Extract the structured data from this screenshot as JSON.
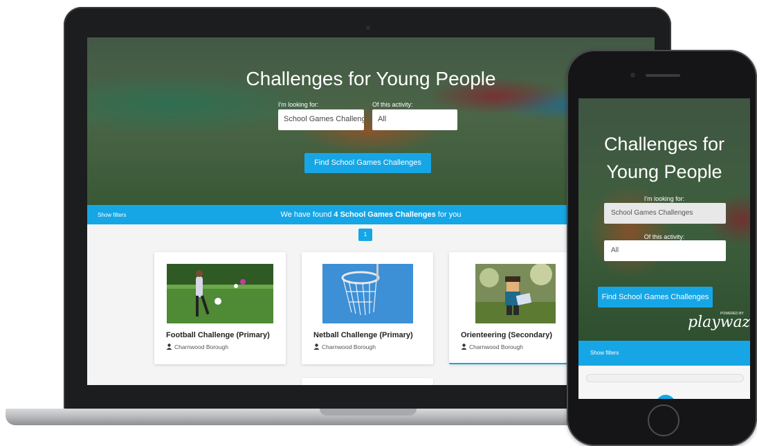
{
  "laptop": {
    "hero": {
      "title": "Challenges for Young People",
      "looking_label": "I'm looking for:",
      "looking_value": "School Games Challeng",
      "activity_label": "Of this activity:",
      "activity_value": "All",
      "find_button": "Find School Games Challenges"
    },
    "filter_bar": {
      "show_filters": "Show filters",
      "found_prefix": "We have found ",
      "found_bold": "4 School Games Challenges",
      "found_suffix": " for you"
    },
    "pagination": {
      "current_page": "1"
    },
    "cards": [
      {
        "title": "Football Challenge (Primary)",
        "location": "Charnwood Borough"
      },
      {
        "title": "Netball Challenge (Primary)",
        "location": "Charnwood Borough"
      },
      {
        "title": "Orienteering (Secondary)",
        "location": "Charnwood Borough"
      }
    ]
  },
  "phone": {
    "title": "Challenges for Young People",
    "looking_label": "I'm looking for:",
    "looking_value": "School Games Challenges",
    "activity_label": "Of this activity:",
    "activity_value": "All",
    "find_button": "Find School Games Challenges",
    "powered_by": "POWERED BY",
    "logo": "playwaze",
    "show_filters": "Show filters"
  },
  "colors": {
    "accent": "#16a6e6",
    "card_bg": "#ffffff",
    "page_bg": "#f4f4f4"
  },
  "icons": {
    "location": "user-icon"
  }
}
